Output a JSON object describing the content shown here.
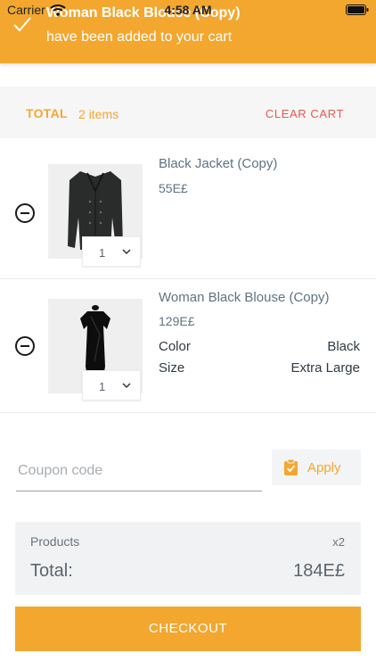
{
  "status_bar": {
    "carrier": "Carrier",
    "time": "4:58 AM"
  },
  "toast": {
    "title": "Woman Black Blouse (Copy)",
    "message": "have been added to your cart"
  },
  "total_bar": {
    "label": "TOTAL",
    "count": "2 items",
    "clear_label": "CLEAR CART"
  },
  "items": [
    {
      "name": "Black Jacket (Copy)",
      "price": "55E£",
      "quantity": "1"
    },
    {
      "name": "Woman Black Blouse (Copy)",
      "price": "129E£",
      "quantity": "1",
      "attributes": [
        {
          "label": "Color",
          "value": "Black"
        },
        {
          "label": "Size",
          "value": "Extra Large"
        }
      ]
    }
  ],
  "coupon": {
    "placeholder": "Coupon code",
    "apply_label": "Apply"
  },
  "summary": {
    "products_label": "Products",
    "products_count": "x2",
    "total_label": "Total:",
    "total_value": "184E£"
  },
  "checkout_label": "CHECKOUT",
  "colors": {
    "accent": "#f3a72f",
    "clear": "#e8584b"
  }
}
